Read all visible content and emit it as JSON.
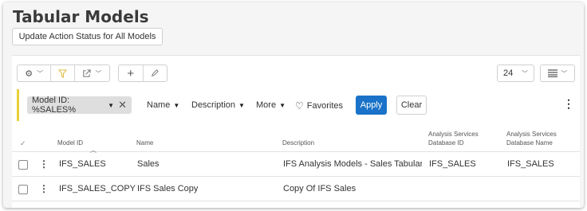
{
  "page": {
    "title": "Tabular Models"
  },
  "actions": {
    "update_label": "Update Action Status for All Models"
  },
  "toolbar": {
    "settings_icon": "gear-icon",
    "filter_icon": "funnel-icon",
    "export_icon": "export-icon",
    "add_icon": "plus-icon",
    "edit_icon": "pencil-icon",
    "page_size": "24",
    "view_icon": "list-view-icon"
  },
  "filters": {
    "chip_label": "Model ID: %SALES%",
    "menus": [
      "Name",
      "Description",
      "More"
    ],
    "favorites_label": "Favorites",
    "apply_label": "Apply",
    "clear_label": "Clear",
    "accent_color": "#e8cf3a",
    "apply_color": "#1a73c8"
  },
  "table": {
    "columns": {
      "model_id": "Model ID",
      "name": "Name",
      "description": "Description",
      "db_id": [
        "Analysis Services",
        "Database ID"
      ],
      "db_name": [
        "Analysis Services",
        "Database Name"
      ]
    },
    "rows": [
      {
        "model_id": "IFS_SALES",
        "name": "Sales",
        "description": "IFS Analysis Models - Sales Tabular Mod",
        "db_id": "IFS_SALES",
        "db_name": "IFS_SALES"
      },
      {
        "model_id": "IFS_SALES_COPY",
        "name": "IFS Sales Copy",
        "description": "Copy Of IFS Sales",
        "db_id": "",
        "db_name": ""
      }
    ]
  }
}
